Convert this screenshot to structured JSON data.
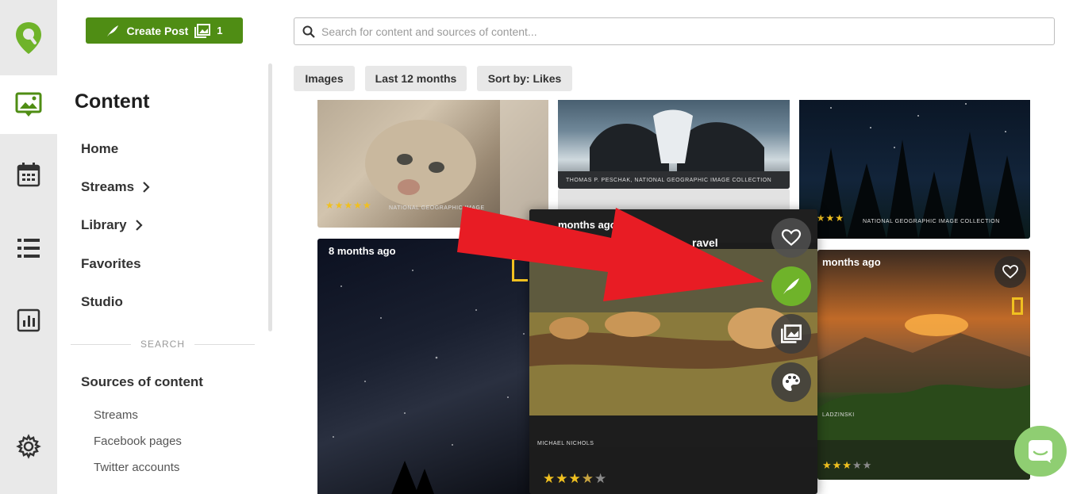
{
  "sidebar": {
    "create_post_label": "Create Post",
    "create_post_count": "1",
    "title": "Content",
    "nav": [
      {
        "label": "Home"
      },
      {
        "label": "Streams"
      },
      {
        "label": "Library"
      },
      {
        "label": "Favorites"
      },
      {
        "label": "Studio"
      }
    ],
    "search_divider": "SEARCH",
    "sources_title": "Sources of content",
    "sources": [
      {
        "label": "Streams"
      },
      {
        "label": "Facebook pages"
      },
      {
        "label": "Twitter accounts"
      }
    ]
  },
  "search": {
    "placeholder": "Search for content and sources of content..."
  },
  "filters": [
    {
      "label": "Images"
    },
    {
      "label": "Last 12 months"
    },
    {
      "label": "Sort by: Likes"
    }
  ],
  "cards": [
    {
      "caption": "NATIONAL GEOGRAPHIC IMAGE",
      "rating": 5
    },
    {
      "caption": "THOMAS P. PESCHAK, NATIONAL GEOGRAPHIC IMAGE COLLECTION"
    },
    {
      "caption": "NATIONAL GEOGRAPHIC IMAGE COLLECTION",
      "rating": 4
    },
    {
      "time": "8 months ago"
    },
    {
      "time": "months ago",
      "caption": "LADZINSKI",
      "rating": 3
    },
    {
      "time": "months ago",
      "title_fragment": "ravel",
      "caption": "MICHAEL NICHOLS",
      "rating": 3.5
    }
  ],
  "colors": {
    "brand_green": "#4f8d14",
    "accent_green": "#6fb32a",
    "star": "#f0c020",
    "arrow_red": "#e81c24",
    "chat": "#8fce72"
  }
}
